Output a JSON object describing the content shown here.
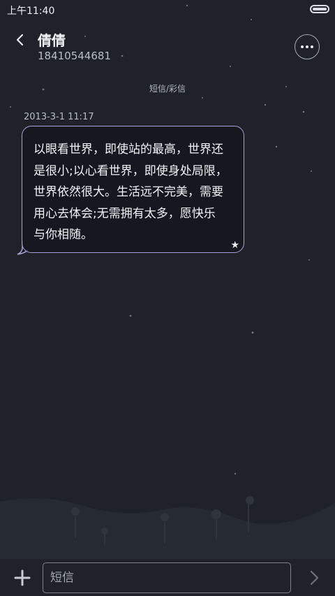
{
  "status_bar": {
    "time": "上午11:40"
  },
  "header": {
    "contact_name": "倩倩",
    "contact_number": "18410544681"
  },
  "thread": {
    "type_label": "短信/彩信",
    "messages": [
      {
        "timestamp": "2013-3-1 11:17",
        "text": "以眼看世界，即使站的最高，世界还\n是很小;以心看世界，即使身处局限，\n世界依然很大。生活远不完美，需要\n用心去体会;无需拥有太多，愿快乐\n与你相随。",
        "star": "★"
      }
    ]
  },
  "composer": {
    "placeholder": "短信"
  },
  "colors": {
    "background": "#1f2229",
    "bubble_border": "#a8a2d8"
  }
}
